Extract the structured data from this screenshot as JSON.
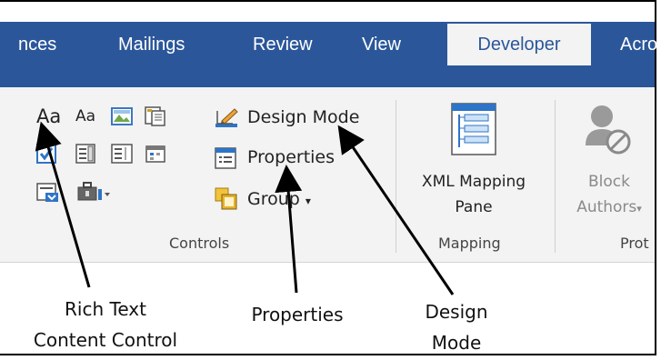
{
  "tabs": [
    {
      "label": "nces"
    },
    {
      "label": "Mailings"
    },
    {
      "label": "Review"
    },
    {
      "label": "View"
    },
    {
      "label": "Developer"
    },
    {
      "label": "Acro"
    }
  ],
  "controls_group": {
    "label": "Controls",
    "design_mode": "Design Mode",
    "properties": "Properties",
    "group": "Group",
    "aa_large": "Aa",
    "aa_small": "Aa"
  },
  "mapping_group": {
    "label": "Mapping",
    "xml_line1": "XML Mapping",
    "xml_line2": "Pane"
  },
  "protect_group": {
    "label": "Prot",
    "block_line1": "Block",
    "block_line2": "Authors"
  },
  "callouts": {
    "rich_text_line1": "Rich Text",
    "rich_text_line2": "Content Control",
    "properties": "Properties",
    "design_line1": "Design",
    "design_line2": "Mode"
  },
  "colors": {
    "tabbar": "#2b579a",
    "ribbon": "#f3f3f3",
    "checkbox_blue": "#2e74c7",
    "disabled_text": "#8a8a8a"
  }
}
